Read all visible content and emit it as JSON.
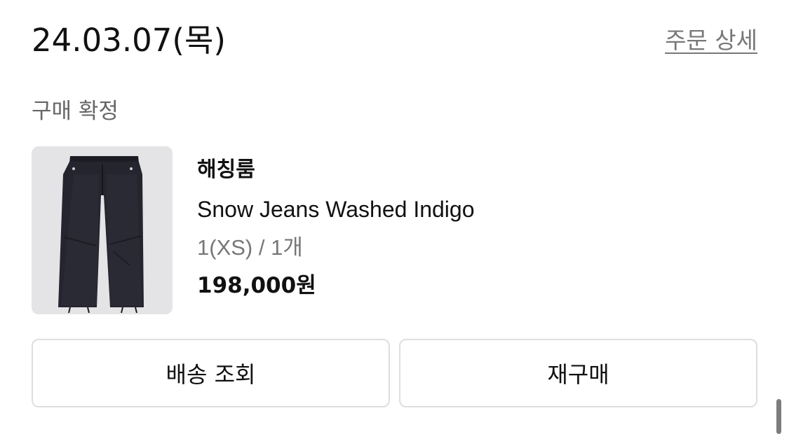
{
  "order": {
    "date": "24.03.07(목)",
    "detail_link": "주문 상세",
    "status": "구매 확정"
  },
  "product": {
    "image_icon": "product-image",
    "brand": "해칭룸",
    "name": "Snow Jeans Washed Indigo",
    "option": "1(XS) / 1개",
    "price": "198,000원"
  },
  "actions": {
    "tracking_label": "배송 조회",
    "reorder_label": "재구매"
  },
  "colors": {
    "text_primary": "#111111",
    "text_secondary": "#777777",
    "thumbnail_bg": "#e4e4e6",
    "button_border": "#dedede"
  }
}
